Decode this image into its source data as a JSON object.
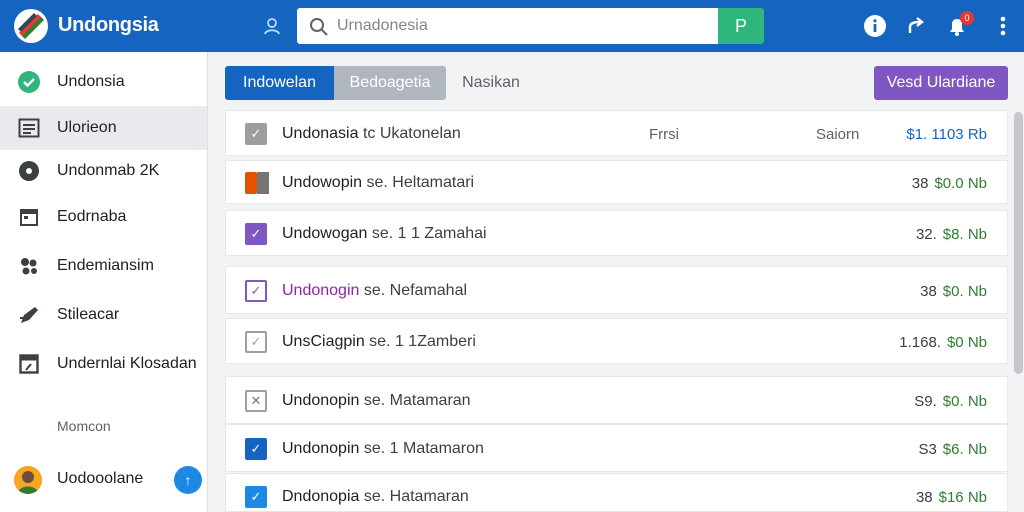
{
  "header": {
    "app_title": "Undongsia",
    "search": {
      "value": "",
      "placeholder": "Urnadonesia"
    },
    "search_go_label": "P",
    "notifications_count": "0",
    "icons": [
      "user-icon",
      "search-icon",
      "info-icon",
      "share-icon",
      "bell-icon",
      "more-vertical-icon"
    ]
  },
  "sidebar": {
    "items": [
      {
        "label": "Undonsia",
        "icon": "check-circle-icon"
      },
      {
        "label": "Ulorieon",
        "icon": "list-icon"
      },
      {
        "label": "Undonmab 2K",
        "icon": "disc-icon"
      },
      {
        "label": "Eodrnaba",
        "icon": "calendar-icon"
      },
      {
        "label": "Endemiansim",
        "icon": "cluster-icon"
      },
      {
        "label": "Stileacar",
        "icon": "pen-icon"
      },
      {
        "label": "Undernlai Klosadan",
        "icon": "note-icon"
      }
    ],
    "section_label": "Momcon",
    "user": {
      "name": "Uodooolane",
      "action_label": "↑"
    }
  },
  "toolbar": {
    "tabs": [
      "Indowelan",
      "Bedoagetia",
      "Nasikan"
    ],
    "primary_button": "Vesd Ulardiane"
  },
  "list": {
    "rows": [
      {
        "name": "Undonasia",
        "detail": "tc Ukatonelan",
        "col1": "Frrsi",
        "col2": "Saiorn",
        "amount": "$1. 1103 Rb",
        "value": "",
        "checkbox": "gray"
      },
      {
        "name": "Undowopin",
        "detail": "se. Heltamatari",
        "col1": "",
        "col2": "",
        "amount": "38",
        "value": "$0.0 Nb",
        "checkbox": "dual"
      },
      {
        "name": "Undowogan",
        "detail": "se. 1 1 Zamahai",
        "col1": "",
        "col2": "",
        "amount": "32.",
        "value": "$8. Nb",
        "checkbox": "purple"
      },
      {
        "name": "Undonogin",
        "detail": "se. Nefamahal",
        "col1": "",
        "col2": "",
        "amount": "38",
        "value": "$0. Nb",
        "checkbox": "purple"
      },
      {
        "name": "UnsCiagpin",
        "detail": "se. 1 1Zamberi",
        "col1": "",
        "col2": "",
        "amount": "1.168.",
        "value": "$0 Nb",
        "checkbox": "gray"
      },
      {
        "name": "Undonopin",
        "detail": "se. Matamaran",
        "col1": "",
        "col2": "",
        "amount": "S9.",
        "value": "$0. Nb",
        "checkbox": "gray-x"
      },
      {
        "name": "Undonopin",
        "detail": "se. 1 Matamaron",
        "col1": "",
        "col2": "",
        "amount": "S3",
        "value": "$6. Nb",
        "checkbox": "blue"
      },
      {
        "name": "Dndonopia",
        "detail": "se. Hatamaran",
        "col1": "",
        "col2": "",
        "amount": "38",
        "value": "$16 Nb",
        "checkbox": "blue"
      }
    ]
  },
  "colors": {
    "header_blue": "#1565c0",
    "search_go_green": "#2eb67d",
    "primary_purple": "#7e57c2",
    "value_green": "#2e7d32",
    "checkbox_blue": "#1565c0",
    "checkbox_purple": "#7e57c2"
  }
}
